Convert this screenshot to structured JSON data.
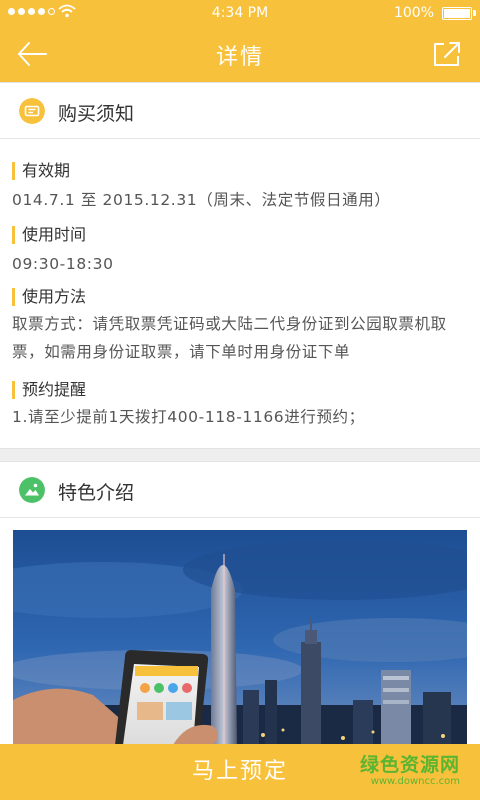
{
  "status_bar": {
    "time": "4:34 PM",
    "battery": "100%",
    "battery_level": 1.0
  },
  "nav": {
    "title": "详情",
    "back_icon": "arrow-left-icon",
    "share_icon": "share-icon"
  },
  "notice_card": {
    "title": "购买须知",
    "icon": "ticket-icon",
    "sections": [
      {
        "label": "有效期",
        "body": "014.7.1 至 2015.12.31（周末、法定节假日通用）"
      },
      {
        "label": "使用时间",
        "body": "09:30-18:30"
      },
      {
        "label": "使用方法",
        "body": "取票方式：请凭取票凭证码或大陆二代身份证到公园取票机取票，如需用身份证取票，请下单时用身份证下单"
      },
      {
        "label": "预约提醒",
        "body": "1.请至少提前1天拨打400-118-1166进行预约；"
      }
    ]
  },
  "feature_card": {
    "title": "特色介绍",
    "icon": "image-icon"
  },
  "bottom": {
    "book_label": "马上预定"
  },
  "watermark": {
    "main": "绿色资源网",
    "sub": "www.downcc.com"
  },
  "colors": {
    "accent": "#f8c13b",
    "feature_icon": "#4cc168",
    "watermark": "#5cb531"
  }
}
